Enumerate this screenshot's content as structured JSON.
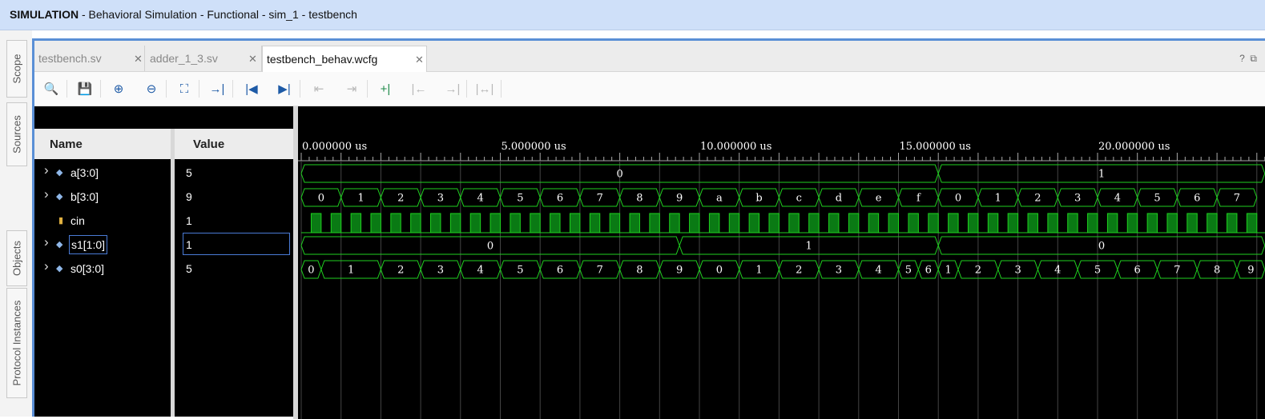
{
  "window": {
    "title_bold": "SIMULATION",
    "title_rest": " - Behavioral Simulation - Functional - sim_1 - testbench"
  },
  "side_tabs": [
    "Scope",
    "Sources",
    "Objects",
    "Protocol Instances"
  ],
  "tabs": [
    {
      "label": "testbench.sv",
      "active": false
    },
    {
      "label": "adder_1_3.sv",
      "active": false
    },
    {
      "label": "testbench_behav.wcfg",
      "active": true
    }
  ],
  "toolbar": [
    {
      "name": "search",
      "glyph": "🔍",
      "enabled": true
    },
    {
      "name": "save",
      "glyph": "💾",
      "enabled": true
    },
    {
      "name": "zoom-in",
      "glyph": "⊕",
      "enabled": true
    },
    {
      "name": "zoom-out",
      "glyph": "⊖",
      "enabled": true
    },
    {
      "name": "zoom-fit",
      "glyph": "⛶",
      "enabled": true
    },
    {
      "name": "go-to-cursor",
      "glyph": "→|",
      "enabled": true
    },
    {
      "name": "go-to-time-0",
      "glyph": "|◀",
      "enabled": true
    },
    {
      "name": "go-to-last-time",
      "glyph": "▶|",
      "enabled": true
    },
    {
      "name": "previous-transition",
      "glyph": "⇤",
      "enabled": false
    },
    {
      "name": "next-transition",
      "glyph": "⇥",
      "enabled": false
    },
    {
      "name": "add-marker",
      "glyph": "+|",
      "enabled": true,
      "green": true
    },
    {
      "name": "previous-marker",
      "glyph": "|←",
      "enabled": false
    },
    {
      "name": "next-marker",
      "glyph": "→|",
      "enabled": false
    },
    {
      "name": "swap-cursors",
      "glyph": "|↔|",
      "enabled": false
    }
  ],
  "headers": {
    "name": "Name",
    "value": "Value"
  },
  "signals": [
    {
      "name": "a[3:0]",
      "value": "5",
      "bus": true
    },
    {
      "name": "b[3:0]",
      "value": "9",
      "bus": true
    },
    {
      "name": "cin",
      "value": "1",
      "bus": false
    },
    {
      "name": "s1[1:0]",
      "value": "1",
      "bus": true,
      "selected": true
    },
    {
      "name": "s0[3:0]",
      "value": "5",
      "bus": true
    }
  ],
  "time_labels": [
    "0.000000 us",
    "5.000000 us",
    "10.000000 us",
    "15.000000 us",
    "20.000000 us"
  ],
  "waves": {
    "ns_per_step": 1,
    "a": [
      {
        "from": 0,
        "to": 16,
        "label": "0"
      },
      {
        "from": 16,
        "to": 24.2,
        "label": "1"
      }
    ],
    "b_labels": [
      "0",
      "1",
      "2",
      "3",
      "4",
      "5",
      "6",
      "7",
      "8",
      "9",
      "a",
      "b",
      "c",
      "d",
      "e",
      "f",
      "0",
      "1",
      "2",
      "3",
      "4",
      "5",
      "6",
      "7"
    ],
    "s1": [
      {
        "from": 0,
        "to": 9.5,
        "label": "0"
      },
      {
        "from": 9.5,
        "to": 16,
        "label": "1"
      },
      {
        "from": 16,
        "to": 24.2,
        "label": "0"
      }
    ],
    "s0": [
      {
        "from": 0,
        "to": 0.5,
        "label": "0"
      },
      {
        "from": 0.5,
        "to": 2,
        "label": "1"
      },
      {
        "from": 2,
        "to": 3,
        "label": "2"
      },
      {
        "from": 3,
        "to": 4,
        "label": "3"
      },
      {
        "from": 4,
        "to": 5,
        "label": "4"
      },
      {
        "from": 5,
        "to": 6,
        "label": "5"
      },
      {
        "from": 6,
        "to": 7,
        "label": "6"
      },
      {
        "from": 7,
        "to": 8,
        "label": "7"
      },
      {
        "from": 8,
        "to": 9,
        "label": "8"
      },
      {
        "from": 9,
        "to": 10,
        "label": "9"
      },
      {
        "from": 10,
        "to": 11,
        "label": "0"
      },
      {
        "from": 11,
        "to": 12,
        "label": "1"
      },
      {
        "from": 12,
        "to": 13,
        "label": "2"
      },
      {
        "from": 13,
        "to": 14,
        "label": "3"
      },
      {
        "from": 14,
        "to": 15,
        "label": "4"
      },
      {
        "from": 15,
        "to": 15.5,
        "label": "5"
      },
      {
        "from": 15.5,
        "to": 16,
        "label": "6"
      },
      {
        "from": 16,
        "to": 16.5,
        "label": "1"
      },
      {
        "from": 16.5,
        "to": 17.5,
        "label": "2"
      },
      {
        "from": 17.5,
        "to": 18.5,
        "label": "3"
      },
      {
        "from": 18.5,
        "to": 19.5,
        "label": "4"
      },
      {
        "from": 19.5,
        "to": 20.5,
        "label": "5"
      },
      {
        "from": 20.5,
        "to": 21.5,
        "label": "6"
      },
      {
        "from": 21.5,
        "to": 22.5,
        "label": "7"
      },
      {
        "from": 22.5,
        "to": 23.5,
        "label": "8"
      },
      {
        "from": 23.5,
        "to": 24.2,
        "label": "9"
      }
    ]
  },
  "colors": {
    "wave": "#1fd11f",
    "wave_fill": "#0a7a14",
    "titlebar": "#cfe0f9"
  }
}
